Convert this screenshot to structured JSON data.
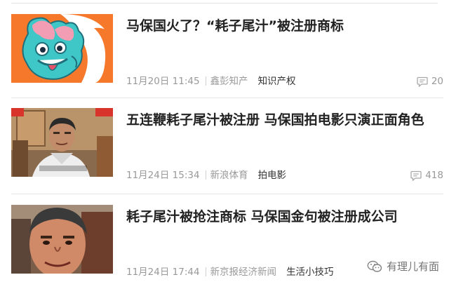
{
  "articles": [
    {
      "title": "马保国火了？“耗子尾汁”被注册商标",
      "date": "11月20日 11:45",
      "source": "鑫彭知产",
      "tag": "知识产权",
      "comments": "20",
      "thumb": "cartoon-mascot-image"
    },
    {
      "title": "五连鞭耗子尾汁被注册 马保国拍电影只演正面角色",
      "date": "11月24日 15:34",
      "source": "新浪体育",
      "tag": "拍电影",
      "comments": "418",
      "thumb": "man-portrait-image"
    },
    {
      "title": "耗子尾汁被抢注商标 马保国金句被注册成公司",
      "date": "11月24日 17:44",
      "source": "新京报经济新闻",
      "tag": "生活小技巧",
      "thumb": "man-closeup-image"
    }
  ],
  "watermark": {
    "text": "有理儿有面",
    "icon": "wechat-icon"
  },
  "colors": {
    "title": "#222222",
    "meta": "#999999",
    "tag": "#333333",
    "divider": "#e6e6e6"
  }
}
